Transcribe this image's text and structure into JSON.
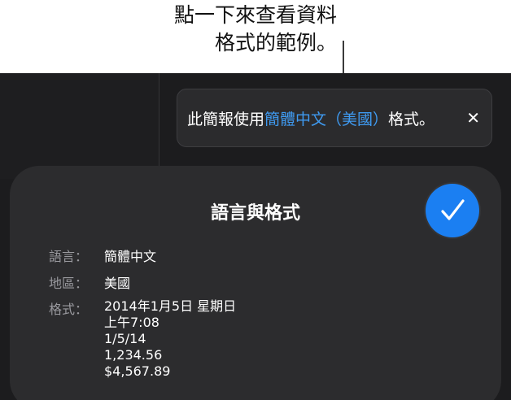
{
  "callout": {
    "line1": "點一下來查看資料",
    "line2": "格式的範例。"
  },
  "banner": {
    "prefix": "此簡報使用",
    "link": "簡體中文（美國）",
    "suffix": "格式。",
    "close_glyph": "✕"
  },
  "sheet": {
    "title": "語言與格式",
    "rows": {
      "language_label": "語言：",
      "language_value": "簡體中文",
      "region_label": "地區：",
      "region_value": "美國",
      "format_label": "格式："
    },
    "format_examples": [
      "2014年1月5日 星期日",
      "上午7:08",
      "1/5/14",
      "1,234.56",
      "$4,567.89"
    ]
  },
  "icons": {
    "done": "checkmark-icon",
    "close": "close-icon"
  },
  "colors": {
    "accent_blue": "#1b7ff2",
    "link_blue": "#3f9bf2",
    "ui_background": "#1c1c1e",
    "sheet_background": "#2c2c2e"
  }
}
